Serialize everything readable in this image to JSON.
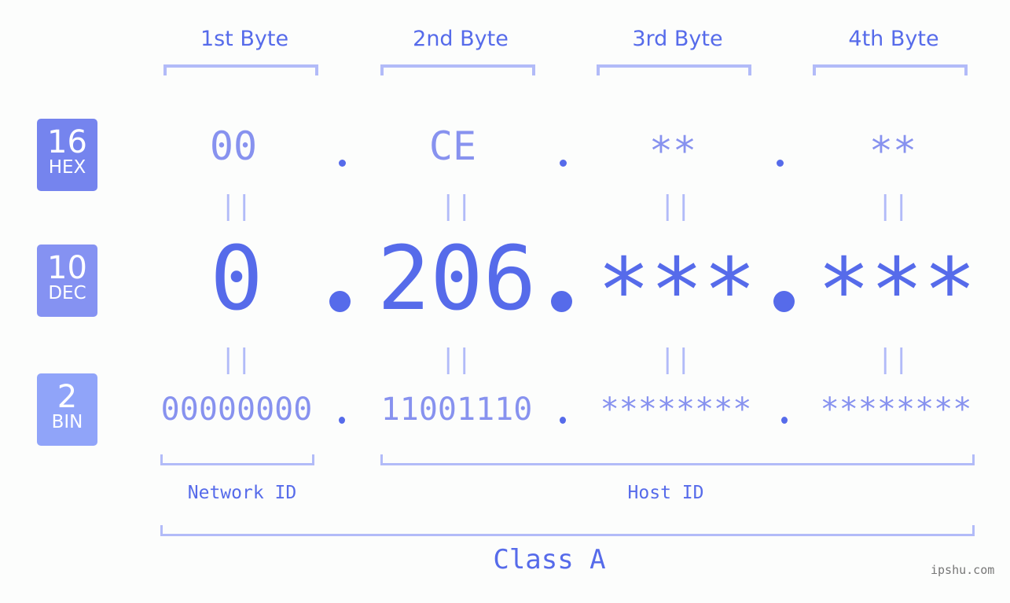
{
  "bytes": [
    {
      "label": "1st Byte",
      "hex": "00",
      "dec": "0",
      "bin": "00000000"
    },
    {
      "label": "2nd Byte",
      "hex": "CE",
      "dec": "206",
      "bin": "11001110"
    },
    {
      "label": "3rd Byte",
      "hex": "**",
      "dec": "***",
      "bin": "********"
    },
    {
      "label": "4th Byte",
      "hex": "**",
      "dec": "***",
      "bin": "********"
    }
  ],
  "rows": {
    "hex": {
      "num": "16",
      "label": "HEX",
      "color": "#7584ee"
    },
    "dec": {
      "num": "10",
      "label": "DEC",
      "color": "#8592f2"
    },
    "bin": {
      "num": "2",
      "label": "BIN",
      "color": "#90a4f9"
    }
  },
  "equals_sign": "||",
  "segments": {
    "network": "Network ID",
    "host": "Host ID"
  },
  "class_label": "Class A",
  "watermark": "ipshu.com"
}
